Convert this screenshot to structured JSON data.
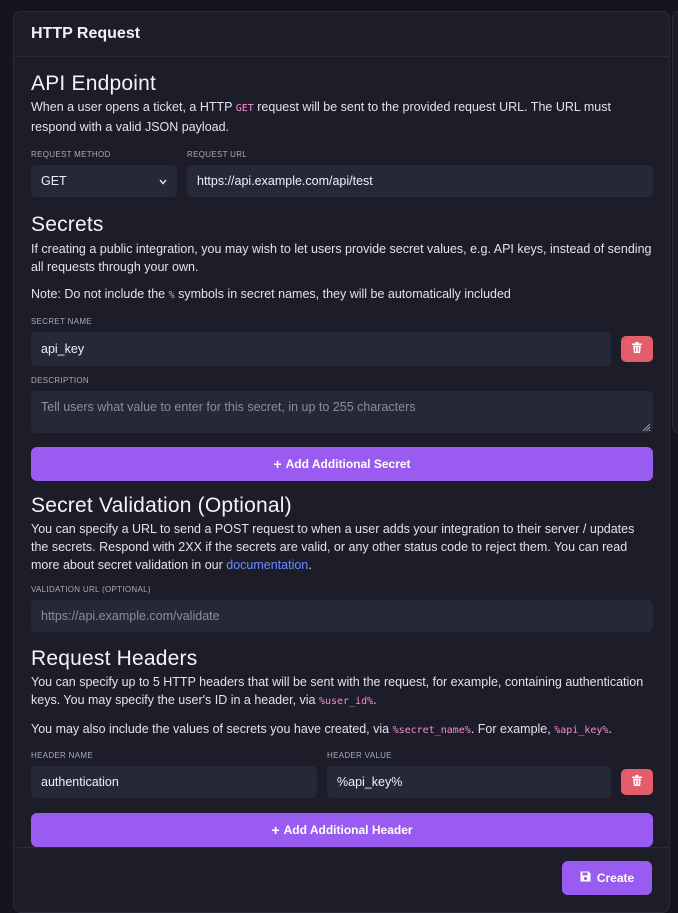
{
  "header": {
    "title": "HTTP Request"
  },
  "api_endpoint": {
    "title": "API Endpoint",
    "desc_before": "When a user opens a ticket, a HTTP ",
    "desc_code": "GET",
    "desc_after": " request will be sent to the provided request URL. The URL must respond with a valid JSON payload.",
    "method_label": "REQUEST METHOD",
    "method_value": "GET",
    "url_label": "REQUEST URL",
    "url_value": "https://api.example.com/api/test"
  },
  "secrets": {
    "title": "Secrets",
    "desc": "If creating a public integration, you may wish to let users provide secret values, e.g. API keys, instead of sending all requests through your own.",
    "note_before": "Note: Do not include the ",
    "note_code": "%",
    "note_after": " symbols in secret names, they will be automatically included",
    "name_label": "SECRET NAME",
    "name_value": "api_key",
    "desc_label": "DESCRIPTION",
    "desc_placeholder": "Tell users what value to enter for this secret, in up to 255 characters",
    "add_button": "Add Additional Secret"
  },
  "validation": {
    "title": "Secret Validation (Optional)",
    "desc_before": "You can specify a URL to send a POST request to when a user adds your integration to their server / updates the secrets. Respond with 2XX if the secrets are valid, or any other status code to reject them. You can read more about secret validation in our ",
    "link": "documentation",
    "desc_after": ".",
    "url_label": "VALIDATION URL (OPTIONAL)",
    "url_placeholder": "https://api.example.com/validate"
  },
  "headers": {
    "title": "Request Headers",
    "desc_before": "You can specify up to 5 HTTP headers that will be sent with the request, for example, containing authentication keys. You may specify the user's ID in a header, via ",
    "desc_code": "%user_id%",
    "desc_after": ".",
    "desc2_before": "You may also include the values of secrets you have created, via ",
    "desc2_code1": "%secret_name%",
    "desc2_mid": ". For example, ",
    "desc2_code2": "%api_key%",
    "desc2_after": ".",
    "name_label": "HEADER NAME",
    "name_value": "authentication",
    "value_label": "HEADER VALUE",
    "value_value": "%api_key%",
    "add_button": "Add Additional Header"
  },
  "footer": {
    "create_label": "Create"
  },
  "colors": {
    "accent": "#9a5cf0",
    "danger": "#e35d6a",
    "link": "#6d8cff",
    "code": "#f58fd0"
  }
}
